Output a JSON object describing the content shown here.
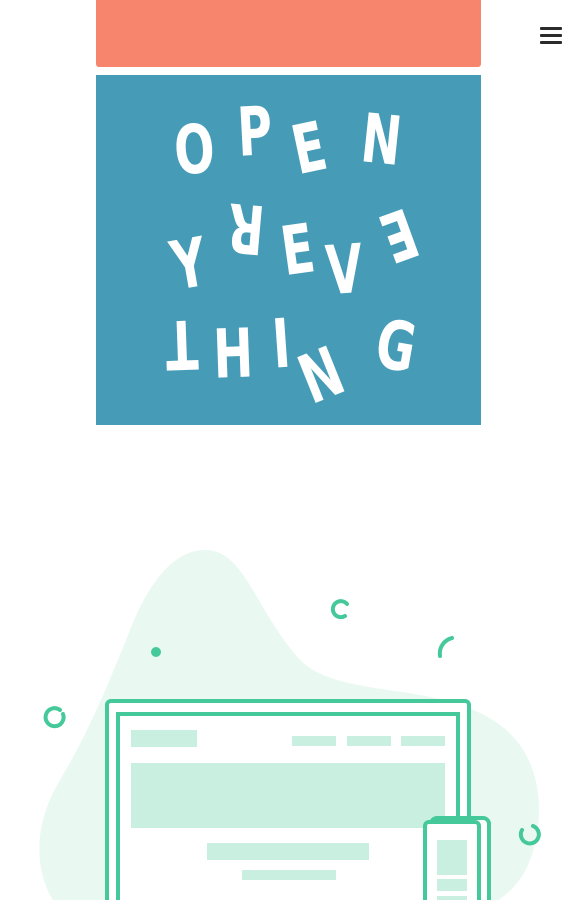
{
  "colors": {
    "coral": "#f7846c",
    "poster_blue": "#469cb7",
    "poster_text": "#ffffff",
    "blob": "#e9f8f1",
    "outline_green": "#45c99a",
    "fill_green": "#c8efdf",
    "menu_icon": "#2b2b2b"
  },
  "header": {
    "menu_icon": "hamburger-menu-icon"
  },
  "poster": {
    "letters": [
      "O",
      "P",
      "E",
      "N",
      "Y",
      "R",
      "E",
      "V",
      "E",
      "T",
      "H",
      "I",
      "N",
      "G"
    ]
  },
  "illustration": {
    "icon": "browser-and-phone-illustration"
  }
}
